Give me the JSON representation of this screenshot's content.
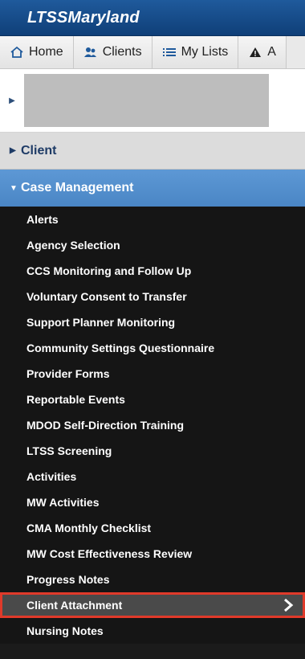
{
  "header": {
    "title": "LTSSMaryland"
  },
  "nav": {
    "tabs": [
      {
        "label": "Home",
        "icon": "home-icon"
      },
      {
        "label": "Clients",
        "icon": "users-icon"
      },
      {
        "label": "My Lists",
        "icon": "list-icon"
      },
      {
        "label": "A",
        "icon": "warning-icon"
      }
    ]
  },
  "sidebar": {
    "client_section": "Client",
    "case_management_section": "Case Management",
    "items": [
      "Alerts",
      "Agency Selection",
      "CCS Monitoring and Follow Up",
      "Voluntary Consent to Transfer",
      "Support Planner Monitoring",
      "Community Settings Questionnaire",
      "Provider Forms",
      "Reportable Events",
      "MDOD Self-Direction Training",
      "LTSS Screening",
      "Activities",
      "MW Activities",
      "CMA Monthly Checklist",
      "MW Cost Effectiveness Review",
      "Progress Notes",
      "Client Attachment",
      "Nursing Notes"
    ],
    "selected_index": 15
  },
  "colors": {
    "header_blue": "#1f5a9c",
    "section_blue": "#4a86c5",
    "menu_bg": "#151515",
    "selected_bg": "#4a4a4a",
    "highlight_red": "#e03a2a"
  }
}
